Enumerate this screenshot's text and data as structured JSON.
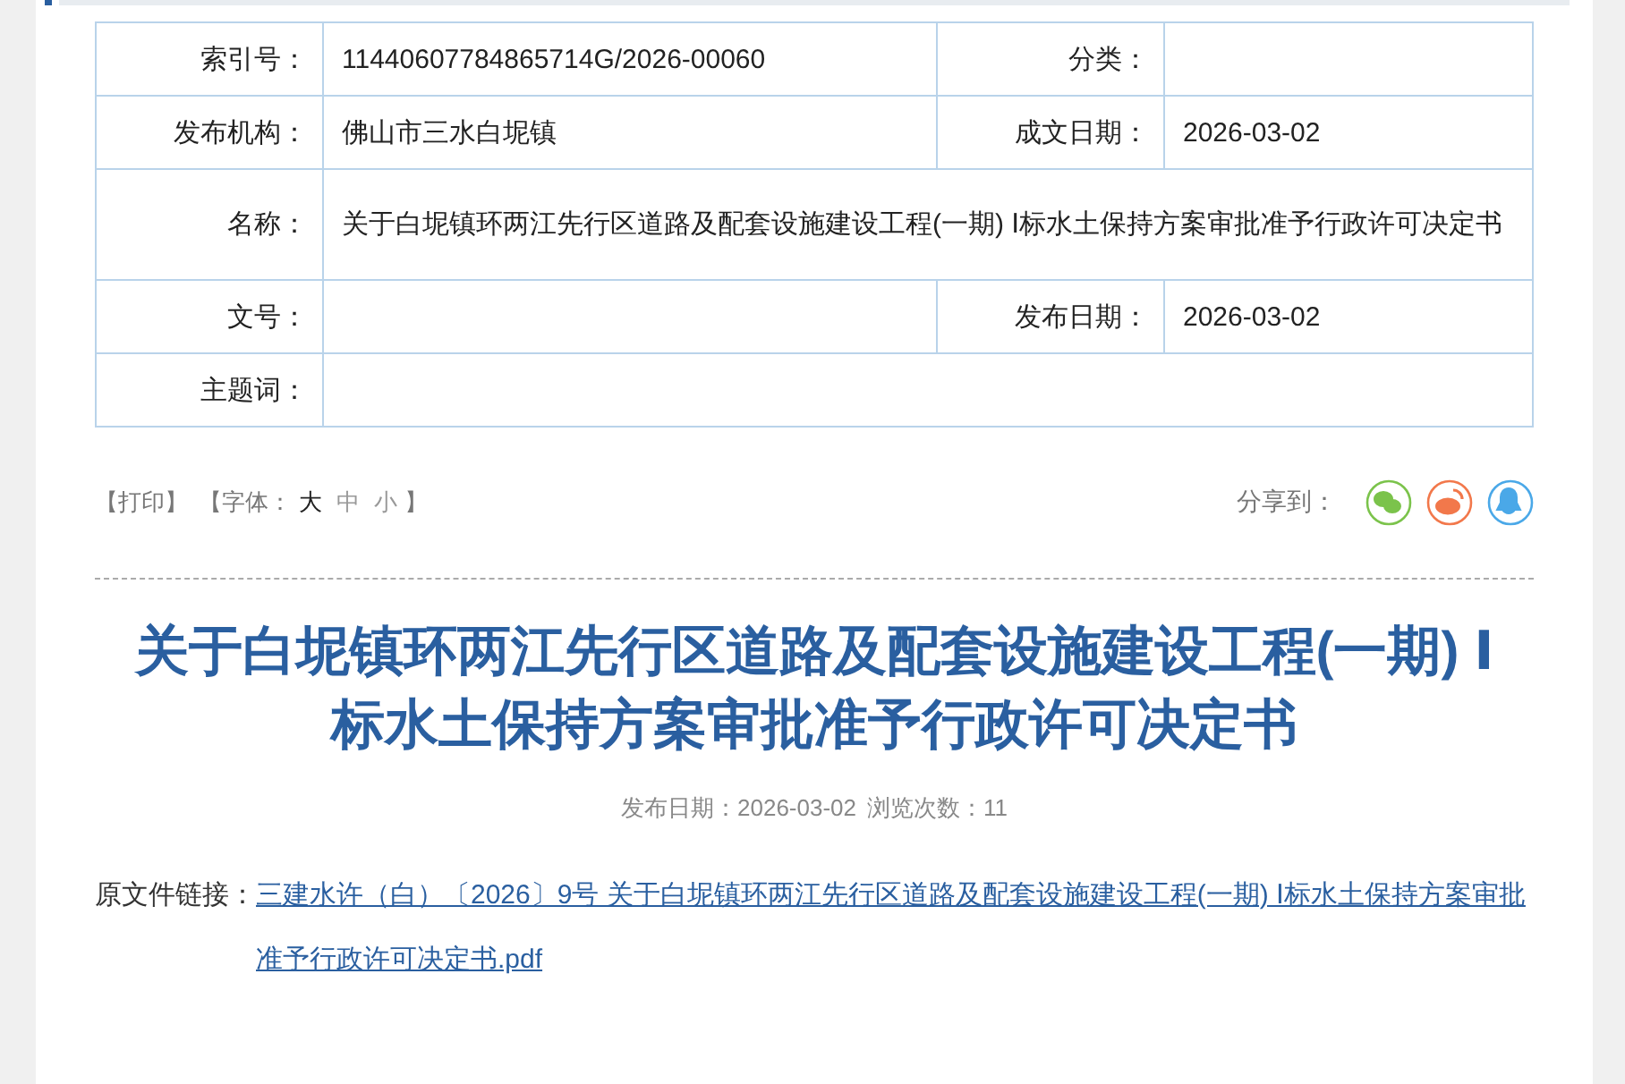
{
  "info_table": {
    "rows": [
      {
        "cells": [
          {
            "label": "索引号：",
            "value": "11440607784865714G/2026-00060"
          },
          {
            "label": "分类："
          }
        ]
      },
      {
        "cells": [
          {
            "label": "发布机构：",
            "value": "佛山市三水白坭镇"
          },
          {
            "label": "成文日期：",
            "value": "2026-03-02"
          }
        ]
      },
      {
        "cells": [
          {
            "label": "名称：",
            "value": "关于白坭镇环两江先行区道路及配套设施建设工程(一期) Ⅰ标水土保持方案审批准予行政许可决定书"
          }
        ]
      },
      {
        "cells": [
          {
            "label": "文号："
          },
          {
            "label": "发布日期：",
            "value": "2026-03-02"
          }
        ]
      },
      {
        "cells": [
          {
            "label": "主题词："
          }
        ]
      }
    ]
  },
  "toolbar": {
    "print": "【打印】",
    "font_label": "【字体：",
    "font_sizes": [
      {
        "label": "大",
        "selected": true
      },
      {
        "label": "中",
        "selected": false
      },
      {
        "label": "小",
        "selected": false
      }
    ],
    "font_end": "】"
  },
  "share": {
    "label": "分享到：",
    "targets": [
      {
        "kind": "wechat",
        "color": "#7bc34b"
      },
      {
        "kind": "weibo",
        "color": "#f2784b"
      },
      {
        "kind": "qq",
        "color": "#4aa8e8"
      }
    ]
  },
  "article": {
    "title": "关于白坭镇环两江先行区道路及配套设施建设工程(一期) Ⅰ标水土保持方案审批准予行政许可决定书",
    "publish_date": "发布日期：2026-03-02",
    "views": "浏览次数：11"
  },
  "source": {
    "label": "原文件链接：",
    "link": "三建水许（白）〔2026〕9号 关于白坭镇环两江先行区道路及配套设施建设工程(一期) Ⅰ标水土保持方案审批准予行政许可决定书.pdf"
  }
}
